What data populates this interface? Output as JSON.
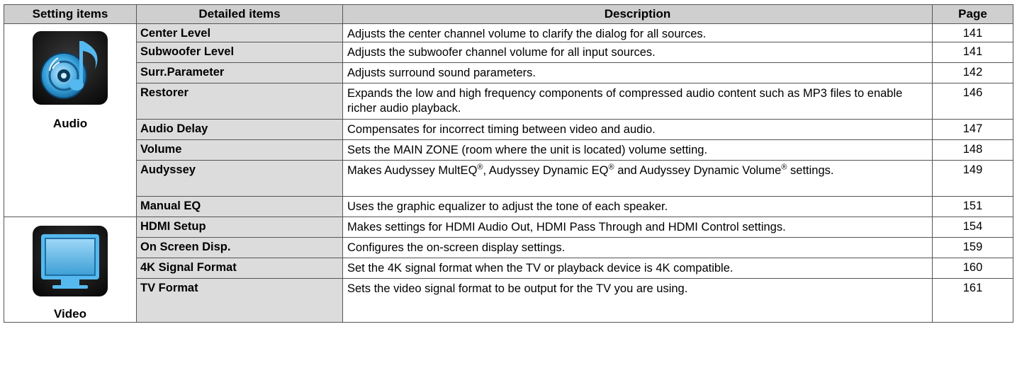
{
  "headers": {
    "setting": "Setting items",
    "detailed": "Detailed items",
    "description": "Description",
    "page": "Page"
  },
  "audio": {
    "label": "Audio",
    "icon": "music-disc-icon",
    "rows": [
      {
        "item": "Center Level",
        "desc": "Adjusts the center channel volume to clarify the dialog for all sources.",
        "page": "141"
      },
      {
        "item": "Subwoofer Level",
        "desc": "Adjusts the subwoofer channel volume for all input sources.",
        "page": "141"
      },
      {
        "item": "Surr.Parameter",
        "desc": "Adjusts surround sound parameters.",
        "page": "142"
      },
      {
        "item": "Restorer",
        "desc": "Expands the low and high frequency components of compressed audio content such as MP3 files to enable richer audio playback.",
        "page": "146"
      },
      {
        "item": "Audio Delay",
        "desc": "Compensates for incorrect timing between video and audio.",
        "page": "147"
      },
      {
        "item": "Volume",
        "desc": "Sets the MAIN ZONE (room where the unit is located) volume setting.",
        "page": "148"
      },
      {
        "item": "Audyssey",
        "desc_parts": [
          "Makes Audyssey MultEQ",
          "®",
          ", Audyssey Dynamic EQ",
          "®",
          " and Audyssey Dynamic Volume",
          "®",
          " settings."
        ],
        "page": "149"
      },
      {
        "item": "Manual EQ",
        "desc": "Uses the graphic equalizer to adjust the tone of each speaker.",
        "page": "151"
      }
    ]
  },
  "video": {
    "label": "Video",
    "icon": "tv-monitor-icon",
    "rows": [
      {
        "item": "HDMI Setup",
        "desc": "Makes settings for HDMI Audio Out, HDMI Pass Through and HDMI Control settings.",
        "page": "154"
      },
      {
        "item": "On Screen Disp.",
        "desc": "Configures the on-screen display settings.",
        "page": "159"
      },
      {
        "item": "4K Signal Format",
        "desc": "Set the 4K signal format when the TV or playback device is 4K compatible.",
        "page": "160"
      },
      {
        "item": "TV Format",
        "desc": "Sets the video signal format to be output for the TV you are using.",
        "page": "161"
      }
    ]
  }
}
